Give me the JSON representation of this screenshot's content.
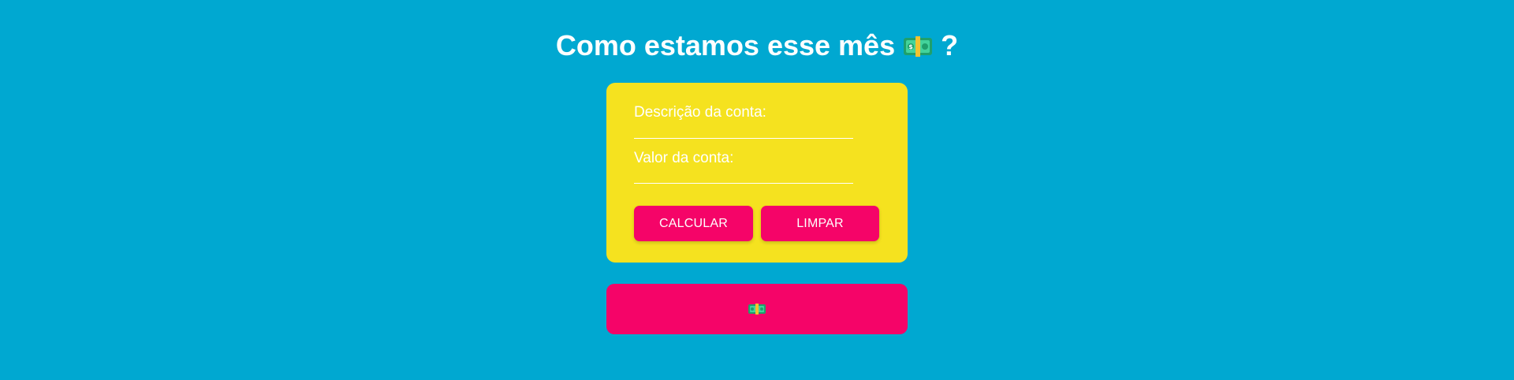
{
  "header": {
    "title": "Como estamos esse mês",
    "title_suffix": "?",
    "title_icon": "money-bill-icon"
  },
  "form": {
    "description_label": "Descrição da conta:",
    "description_value": "",
    "value_label": "Valor da conta:",
    "value_value": "",
    "calculate_label": "CALCULAR",
    "clear_label": "LIMPAR"
  },
  "result": {
    "icon": "money-bill-icon",
    "text": ""
  },
  "colors": {
    "background": "#00a8d1",
    "card": "#f5e21f",
    "accent": "#f50468",
    "text": "#ffffff"
  }
}
